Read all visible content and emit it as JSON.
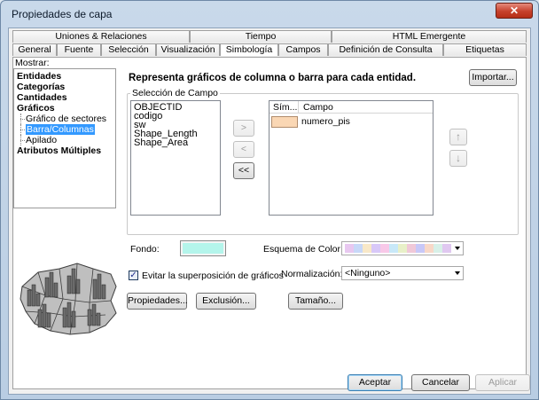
{
  "window": {
    "title": "Propiedades de capa",
    "close_glyph": "✕"
  },
  "tabs_row1": [
    "Uniones & Relaciones",
    "Tiempo",
    "HTML Emergente"
  ],
  "tabs_row2": [
    "General",
    "Fuente",
    "Selección",
    "Visualización",
    "Simbología",
    "Campos",
    "Definición de Consulta",
    "Etiquetas"
  ],
  "active_tab": "Simbología",
  "show": {
    "label": "Mostrar:",
    "items": [
      {
        "label": "Entidades",
        "bold": true
      },
      {
        "label": "Categorías",
        "bold": true
      },
      {
        "label": "Cantidades",
        "bold": true
      },
      {
        "label": "Gráficos",
        "bold": true
      },
      {
        "label": "Gráfico de sectores",
        "sub": true
      },
      {
        "label": "Barra/Columnas",
        "sub": true,
        "selected": true
      },
      {
        "label": "Apilado",
        "sub": true
      },
      {
        "label": "Atributos Múltiples",
        "bold": true
      }
    ]
  },
  "description": "Representa gráficos de columna o barra para cada entidad.",
  "import_button": "Importar...",
  "field_selection": {
    "group_label": "Selección de Campo",
    "available_fields": [
      "OBJECTID",
      "codigo",
      "sw",
      "Shape_Length",
      "Shape_Area"
    ],
    "buttons": {
      "add": ">",
      "remove": "<",
      "remove_all": "<<"
    },
    "table_headers": {
      "symbol": "Sím...",
      "field": "Campo"
    },
    "selected_fields": [
      {
        "color": "#fad7b4",
        "field": "numero_pis"
      }
    ],
    "move_up": "↑",
    "move_down": "↓"
  },
  "background": {
    "label": "Fondo:",
    "color": "#b4f5eb"
  },
  "color_scheme": {
    "label": "Esquema de Color:",
    "swatches": [
      "#e8c8f0",
      "#c8d8f8",
      "#f8e8c8",
      "#d8c8f8",
      "#f8c8e8",
      "#c8e8f8",
      "#e8f0c8",
      "#f0c8d8",
      "#c8c8f8",
      "#f8d8c8",
      "#d8f0e8",
      "#e0c8f0"
    ]
  },
  "avoid_overlap": {
    "label": "Evitar la superposición de gráficos",
    "checked": true,
    "check_glyph": "✓"
  },
  "normalization": {
    "label": "Normalización:",
    "value": "<Ninguno>"
  },
  "buttons": {
    "properties": "Propiedades...",
    "exclusion": "Exclusión...",
    "size": "Tamaño..."
  },
  "footer": {
    "accept": "Aceptar",
    "cancel": "Cancelar",
    "apply": "Aplicar"
  }
}
